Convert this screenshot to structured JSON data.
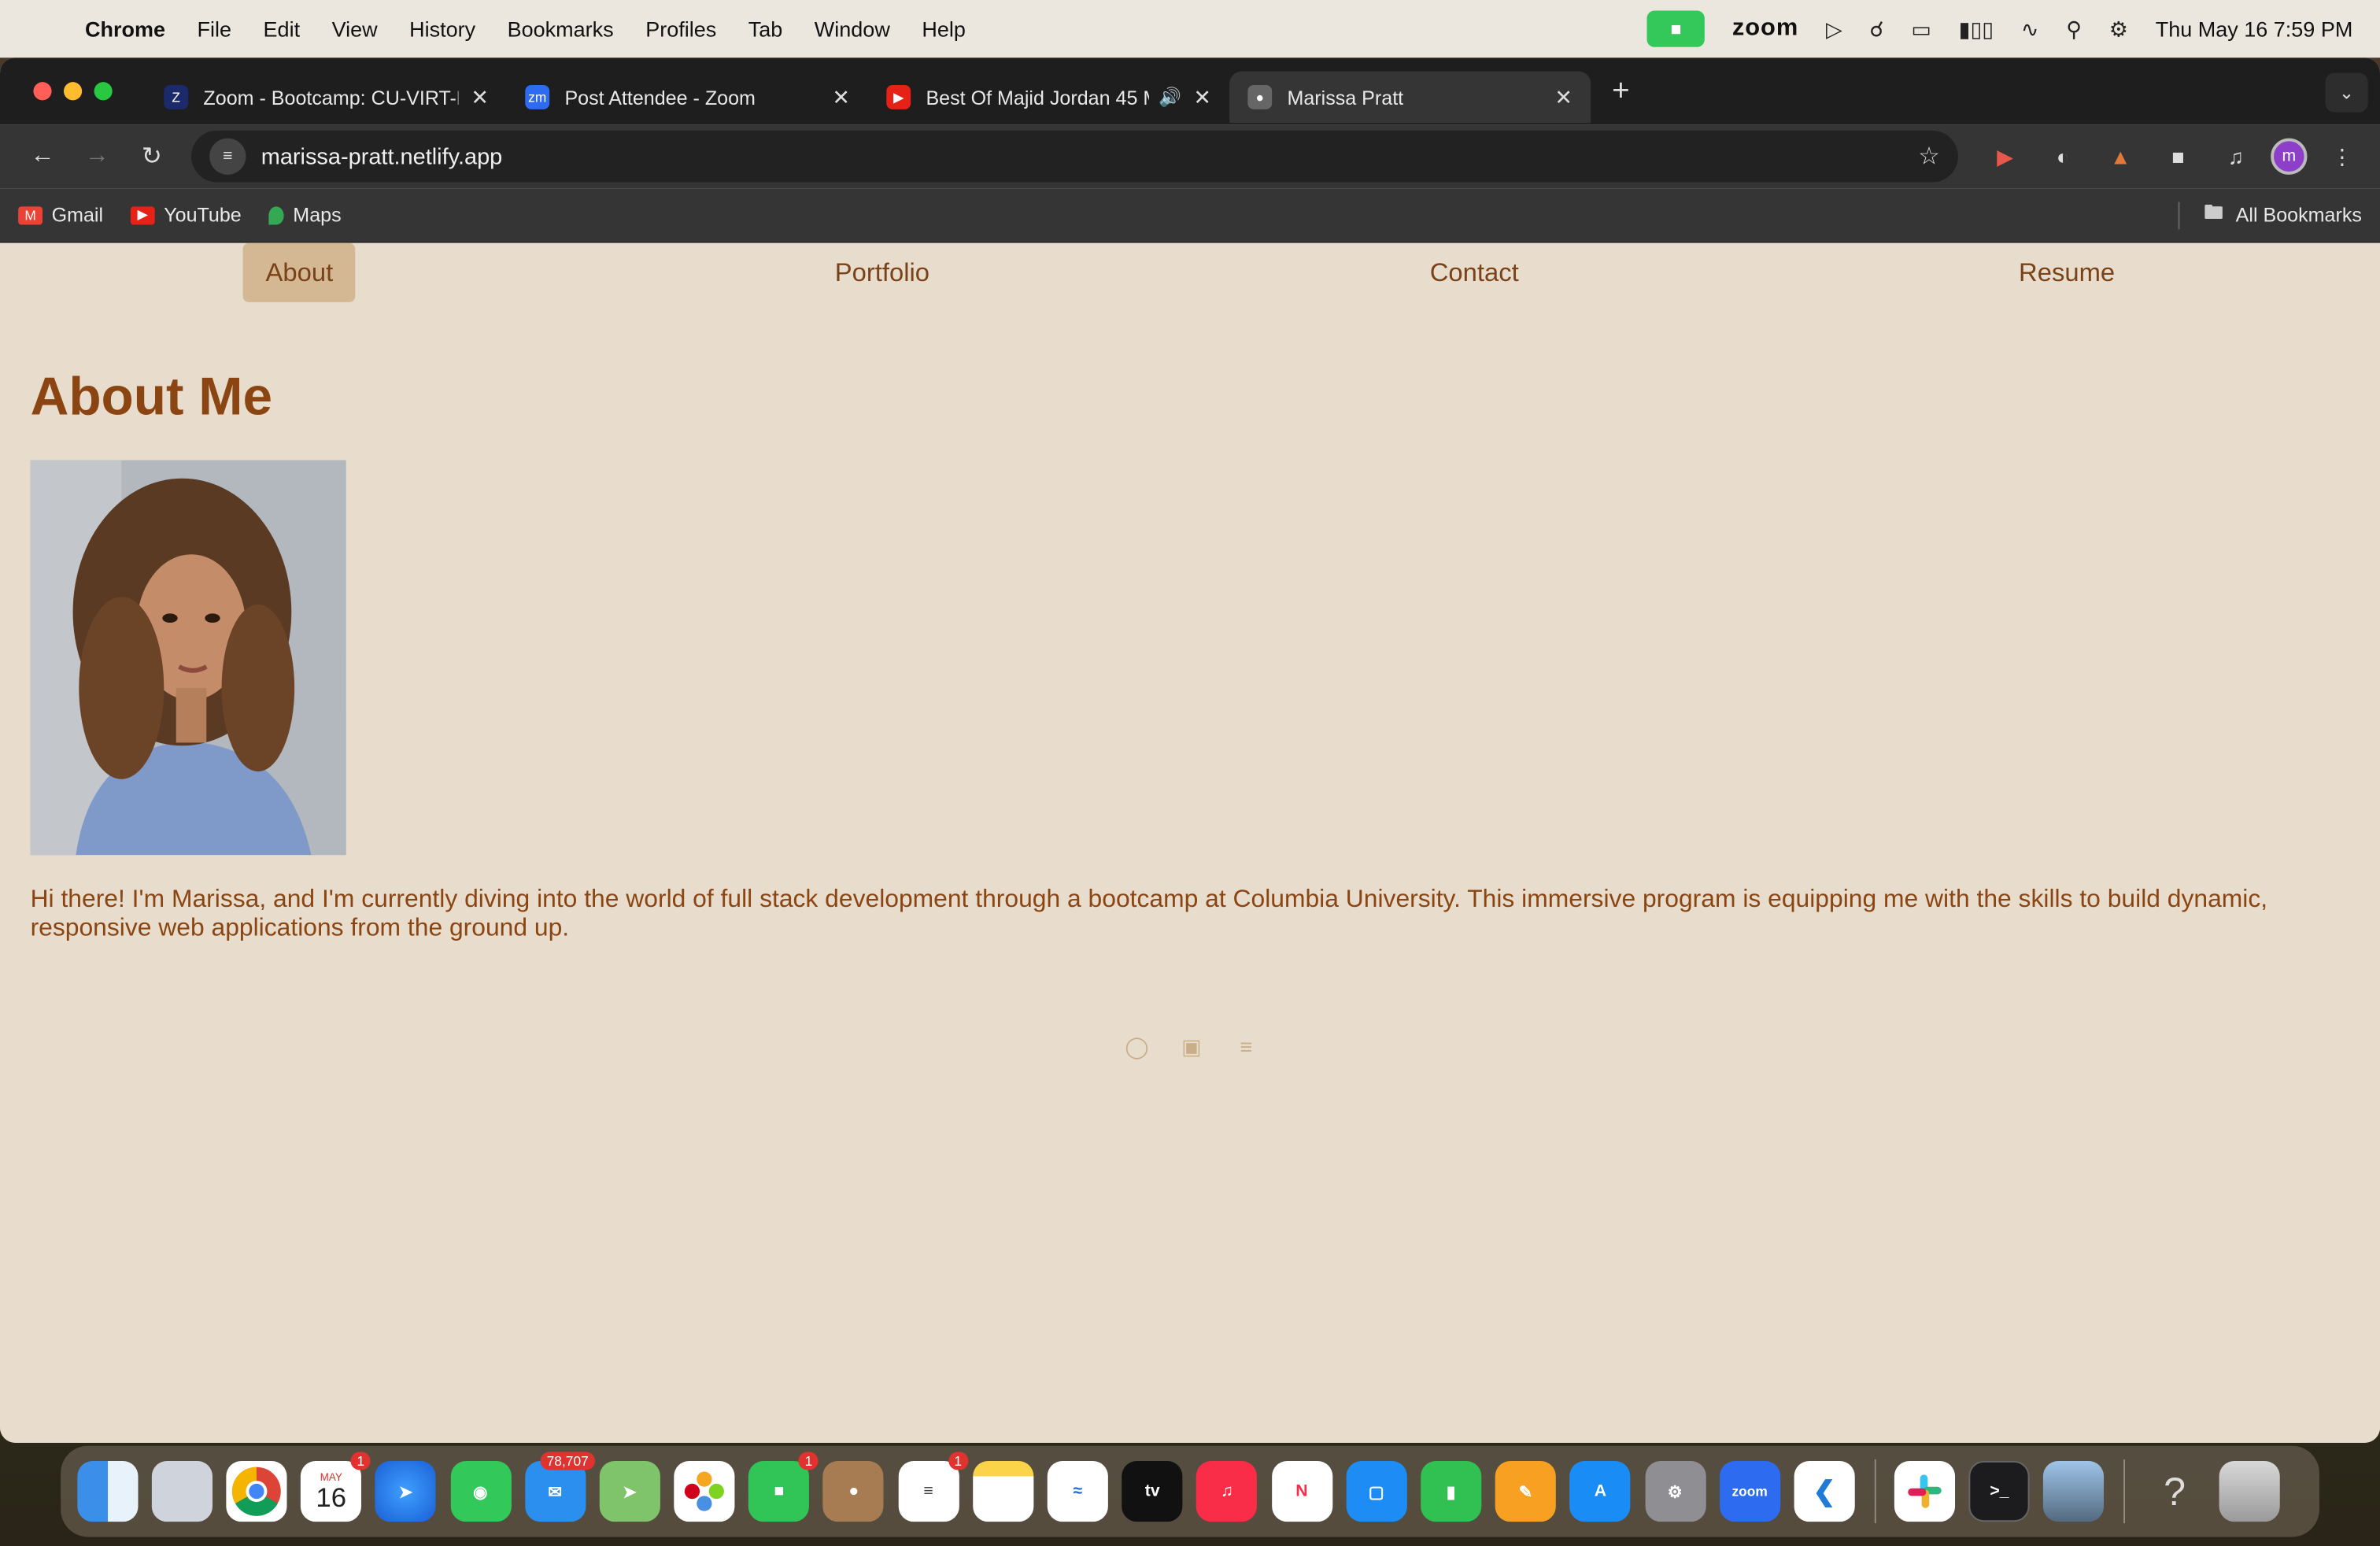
{
  "menubar": {
    "app_name": "Chrome",
    "items": [
      "File",
      "Edit",
      "View",
      "History",
      "Bookmarks",
      "Profiles",
      "Tab",
      "Window",
      "Help"
    ],
    "zoom_label": "zoom",
    "clock": "Thu May 16  7:59 PM"
  },
  "browser": {
    "tabs": [
      {
        "title": "Zoom - Bootcamp: CU-VIRT-F",
        "favicon": "zoom-icon"
      },
      {
        "title": "Post Attendee - Zoom",
        "favicon": "zoom-icon"
      },
      {
        "title": "Best Of Majid Jordan 45 M",
        "favicon": "youtube-icon"
      },
      {
        "title": "Marissa Pratt",
        "favicon": "globe-icon"
      }
    ],
    "active_tab_index": 3,
    "address": "marissa-pratt.netlify.app",
    "profile_initial": "m",
    "bookmarks": [
      "Gmail",
      "YouTube",
      "Maps"
    ],
    "all_bookmarks_label": "All Bookmarks"
  },
  "page": {
    "nav": [
      "About",
      "Portfolio",
      "Contact",
      "Resume"
    ],
    "active_nav": "About",
    "heading": "About Me",
    "bio": "Hi there! I'm Marissa, and I'm currently diving into the world of full stack development through a bootcamp at Columbia University. This immersive program is equipping me with the skills to build dynamic, responsive web applications from the ground up.",
    "social_icons": [
      "github-icon",
      "linkedin-icon",
      "stackoverflow-icon"
    ]
  },
  "dock": {
    "calendar_month": "MAY",
    "calendar_day": "16",
    "badges": {
      "calendar": "1",
      "mail": "78,707",
      "facetime": "1",
      "reminders": "1"
    },
    "tv_label": "tv",
    "zoom_label": "zoom"
  },
  "colors": {
    "page_bg": "#e8ddcc",
    "text_brown": "#8b4513",
    "active_nav_bg": "#d4b894",
    "chrome_dark": "#353535"
  }
}
